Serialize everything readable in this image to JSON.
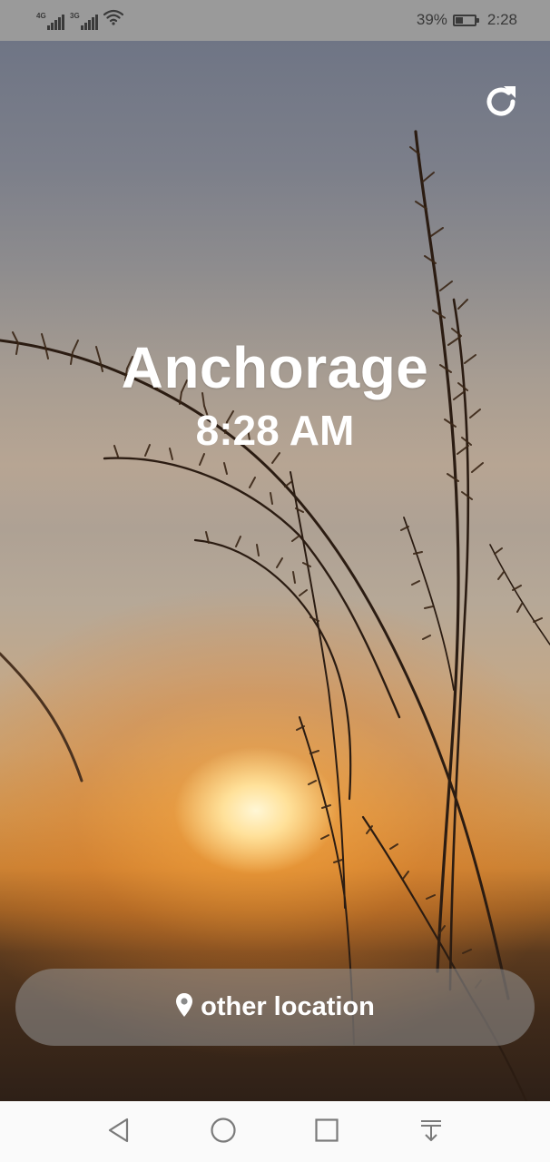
{
  "status_bar": {
    "network_1": "4G",
    "network_2": "3G",
    "battery_percent": "39%",
    "battery_level": 0.39,
    "time": "2:28",
    "icons": [
      "signal-4g-icon",
      "signal-3g-icon",
      "wifi-icon",
      "battery-icon"
    ]
  },
  "main": {
    "city": "Anchorage",
    "time": "8:28 AM",
    "refresh_icon": "refresh-icon",
    "location_button": {
      "icon": "location-pin-icon",
      "label": "other location"
    }
  },
  "nav_bar": {
    "items": [
      "back-icon",
      "home-icon",
      "recents-icon",
      "notification-pull-icon"
    ]
  },
  "colors": {
    "text": "#ffffff",
    "status_bar": "#9a9a9a",
    "nav_bar": "#fafafa",
    "button_overlay": "rgba(150,150,150,0.55)"
  }
}
